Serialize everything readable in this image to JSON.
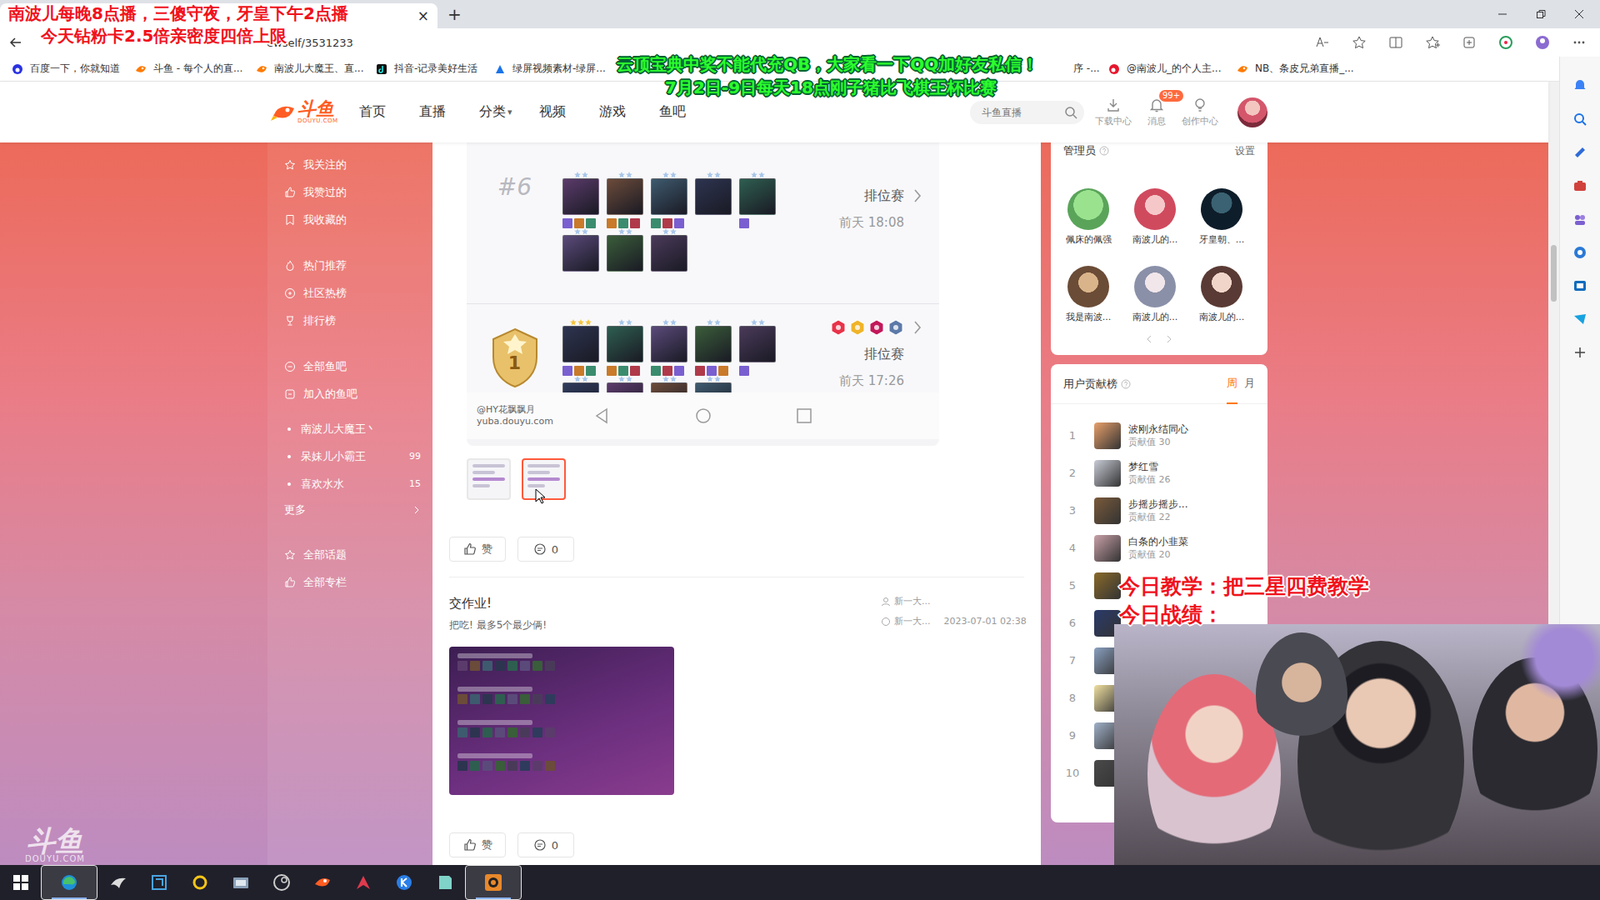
{
  "browser": {
    "tab_close": "×",
    "new_tab": "+",
    "address": "ewself/3531233",
    "bookmarks": [
      {
        "label": "百度一下，你就知道",
        "kind": "baidu"
      },
      {
        "label": "斗鱼 - 每个人的直...",
        "kind": "douyu"
      },
      {
        "label": "南波儿大魔王、直...",
        "kind": "douyu"
      },
      {
        "label": "抖音-记录美好生活",
        "kind": "tiktok"
      },
      {
        "label": "绿屏视频素材-绿屏...",
        "kind": "green"
      },
      {
        "label": "序 -...",
        "kind": "hidden"
      },
      {
        "label": "@南波儿_的个人主...",
        "kind": "weibo"
      },
      {
        "label": "NB、条皮兄弟直播_...",
        "kind": "douyu"
      }
    ]
  },
  "overlays": {
    "top_left": [
      "南波儿每晚8点播，三傻守夜，牙皇下午2点播",
      "今天钻粉卡2.5倍亲密度四倍上限"
    ],
    "top_center": [
      "云顶宝典中奖不能代充QB，大家看一下QQ加好友私信！",
      "7月2日-9日每天18点刚子猪比飞棋王杯比赛"
    ],
    "bottom_right": [
      "今日教学：把三星四费教学",
      "今日战绩："
    ]
  },
  "site": {
    "logo": "斗鱼",
    "logo_sub": "DOUYU.COM",
    "nav": [
      {
        "label": "首页",
        "selected": false
      },
      {
        "label": "直播",
        "selected": false
      },
      {
        "label": "分类",
        "selected": false,
        "caret": "▾"
      },
      {
        "label": "视频",
        "selected": false
      },
      {
        "label": "游戏",
        "selected": false
      },
      {
        "label": "鱼吧",
        "selected": false
      }
    ],
    "search": {
      "placeholder": "斗鱼直播"
    },
    "tools": [
      {
        "label": "下载中心",
        "kind": "download"
      },
      {
        "label": "消息",
        "kind": "bell",
        "badge": "99+"
      },
      {
        "label": "创作中心",
        "kind": "bulb"
      }
    ]
  },
  "sidebar": {
    "groups": [
      {
        "items": [
          {
            "label": "我关注的",
            "kind": "link"
          },
          {
            "label": "我赞过的",
            "kind": "link"
          },
          {
            "label": "我收藏的",
            "kind": "link"
          }
        ]
      },
      {
        "items": [
          {
            "label": "热门推荐",
            "kind": "link"
          },
          {
            "label": "社区热榜",
            "kind": "link"
          },
          {
            "label": "排行榜",
            "kind": "link"
          }
        ]
      },
      {
        "items": [
          {
            "label": "全部鱼吧",
            "kind": "link"
          },
          {
            "label": "加入的鱼吧",
            "kind": "link"
          },
          {
            "label": "南波儿大魔王丶",
            "kind": "bar"
          },
          {
            "label": "呆妹儿小霸王",
            "kind": "bar",
            "count": "99"
          },
          {
            "label": "喜欢水水",
            "kind": "bar",
            "count": "15"
          },
          {
            "label": "更多",
            "kind": "more"
          }
        ]
      },
      {
        "items": [
          {
            "label": "全部话题",
            "kind": "link"
          },
          {
            "label": "全部专栏",
            "kind": "link"
          }
        ]
      }
    ]
  },
  "feed": {
    "matches": [
      {
        "placement": "#6",
        "kind": "rank",
        "mode": "排位赛",
        "time": "前天 18:08",
        "traits": [],
        "units": [
          {
            "stars": 2,
            "items": 3
          },
          {
            "stars": 2,
            "items": 3
          },
          {
            "stars": 2,
            "items": 3
          },
          {
            "stars": 2,
            "items": 0
          },
          {
            "stars": 2,
            "items": 1
          },
          {
            "stars": 2,
            "items": 0
          },
          {
            "stars": 2,
            "items": 0
          },
          {
            "stars": 2,
            "items": 0
          }
        ]
      },
      {
        "placement": "1",
        "kind": "badge",
        "mode": "排位赛",
        "time": "前天 17:26",
        "traits": [
          {
            "color": "#e8334a"
          },
          {
            "color": "#f0b429"
          },
          {
            "color": "#c2185b"
          },
          {
            "color": "#5c7aa8"
          }
        ],
        "units": [
          {
            "stars": 3,
            "items": 3
          },
          {
            "stars": 2,
            "items": 3
          },
          {
            "stars": 2,
            "items": 3
          },
          {
            "stars": 2,
            "items": 3
          },
          {
            "stars": 2,
            "items": 1
          },
          {
            "stars": 2,
            "items": 0
          },
          {
            "stars": 2,
            "items": 0
          },
          {
            "stars": 2,
            "items": 0
          },
          {
            "stars": 2,
            "items": 0
          }
        ]
      }
    ],
    "watermark": [
      "@HY花飘飘月",
      "yuba.douyu.com"
    ],
    "thumbs": [
      {
        "selected": false
      },
      {
        "selected": true
      }
    ],
    "actions": {
      "like": "赞",
      "comments": "0"
    },
    "post": {
      "title": "交作业!",
      "body": "把吃! 最多5个最少俩!",
      "author": "新一大...",
      "reply": "新一大...",
      "date": "2023-07-01 02:38",
      "actions": {
        "like": "赞",
        "comments": "0"
      }
    }
  },
  "admins": {
    "title": "管理员",
    "settings": "设置",
    "members": [
      {
        "name": "佩床的佩强"
      },
      {
        "name": "南波儿的..."
      },
      {
        "name": "牙皇朝、..."
      },
      {
        "name": "我是南波..."
      },
      {
        "name": "南波儿的..."
      },
      {
        "name": "南波儿的..."
      }
    ]
  },
  "contrib": {
    "title": "用户贡献榜",
    "tabs": [
      {
        "label": "周",
        "selected": true
      },
      {
        "label": "月",
        "selected": false
      }
    ],
    "rows": [
      {
        "rank": "1",
        "name": "波刚永结同心",
        "score": "贡献值 30"
      },
      {
        "rank": "2",
        "name": "梦红雪",
        "score": "贡献值 26"
      },
      {
        "rank": "3",
        "name": "步摇步摇步...",
        "score": "贡献值 22"
      },
      {
        "rank": "4",
        "name": "白条的小韭菜",
        "score": "贡献值 20"
      },
      {
        "rank": "5"
      },
      {
        "rank": "6"
      },
      {
        "rank": "7"
      },
      {
        "rank": "8"
      },
      {
        "rank": "9"
      },
      {
        "rank": "10"
      }
    ]
  },
  "watermark": {
    "logo": "斗鱼",
    "sub": "DOUYU.COM"
  },
  "taskbar": {
    "apps": [
      {
        "kind": "windows",
        "active": false
      },
      {
        "kind": "edge",
        "active": true
      },
      {
        "kind": "bird",
        "active": false
      },
      {
        "kind": "square",
        "active": false
      },
      {
        "kind": "ring",
        "active": false
      },
      {
        "kind": "folder",
        "active": false
      },
      {
        "kind": "steam",
        "active": false
      },
      {
        "kind": "douyu",
        "active": false
      },
      {
        "kind": "arrow",
        "active": false
      },
      {
        "kind": "kook",
        "active": false
      },
      {
        "kind": "note",
        "active": false
      },
      {
        "kind": "obs",
        "active": true
      }
    ]
  }
}
